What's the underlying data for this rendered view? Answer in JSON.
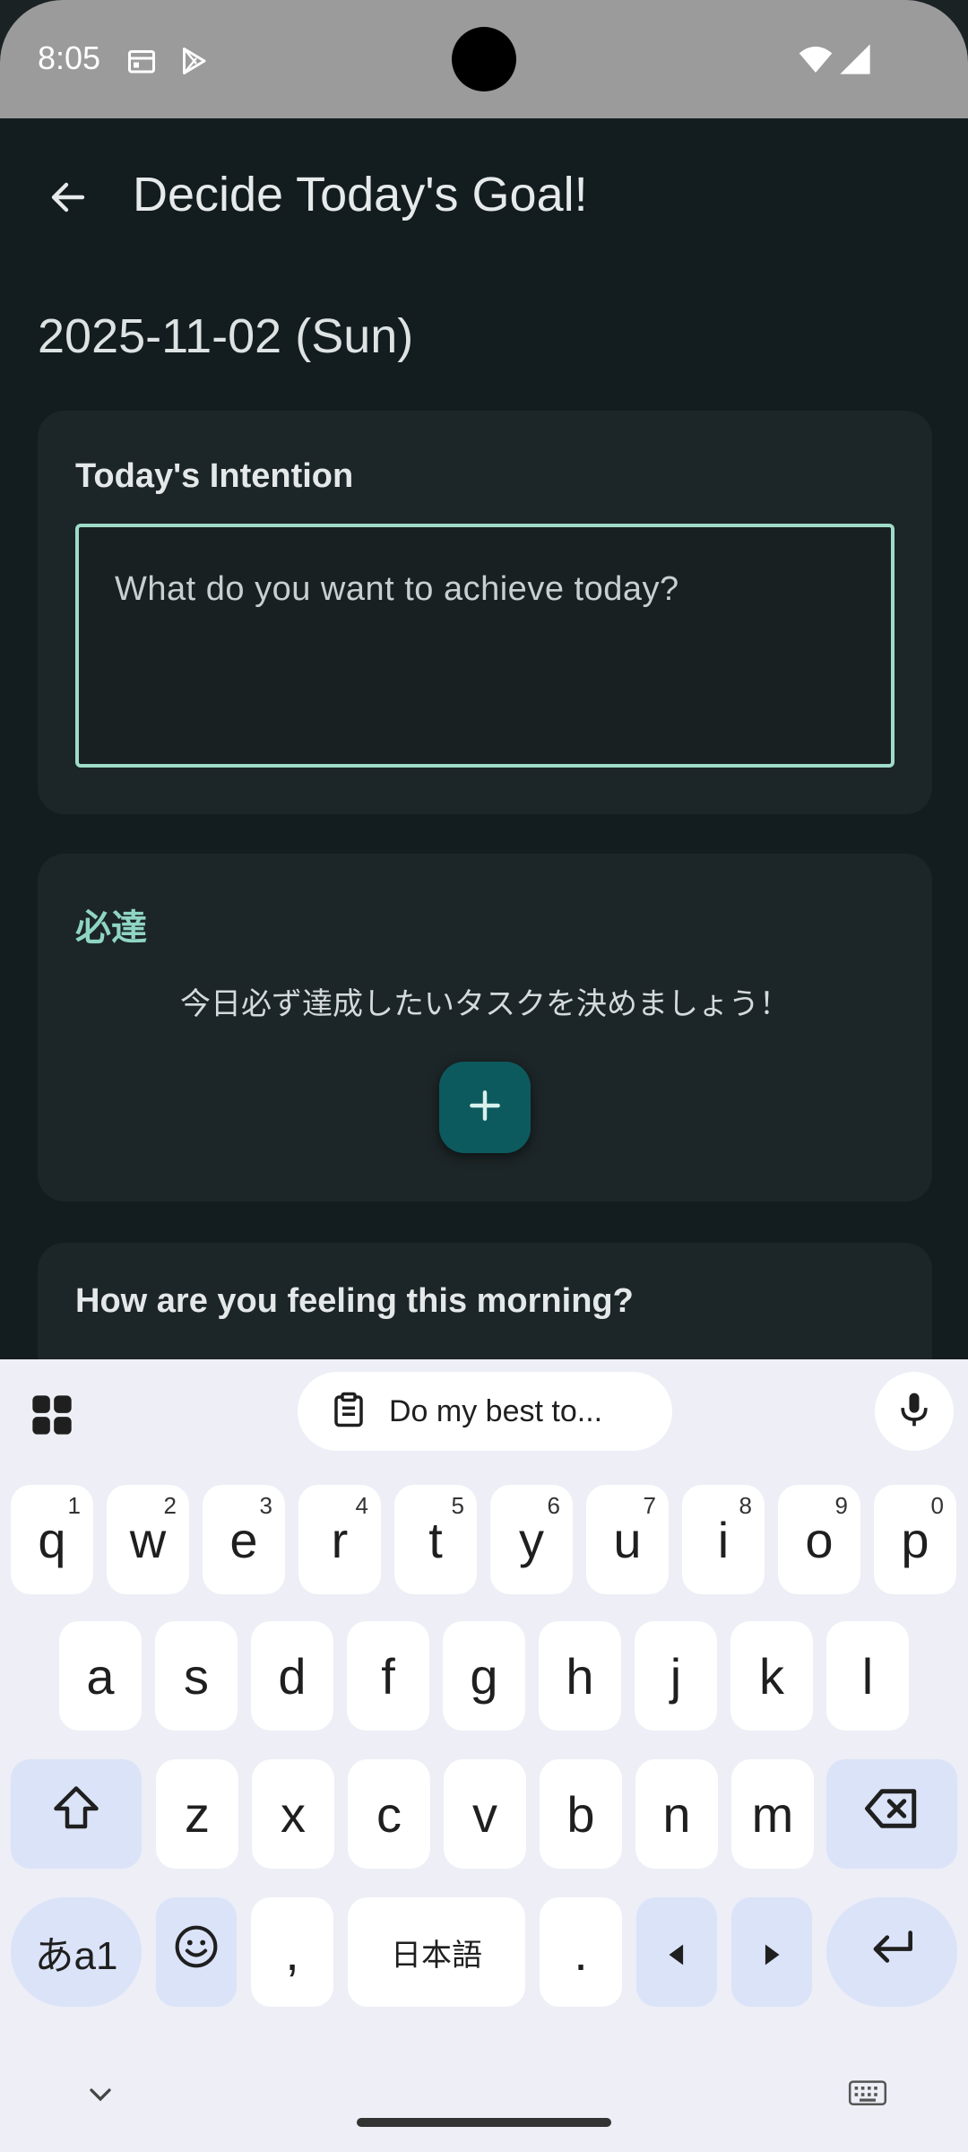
{
  "status_bar": {
    "time": "8:05",
    "icons": [
      "calendar-icon",
      "play-store-icon",
      "wifi-icon",
      "signal-icon"
    ]
  },
  "app_bar": {
    "title": "Decide Today's Goal!",
    "back_icon": "arrow-back-icon"
  },
  "date": "2025-11-02 (Sun)",
  "intention_card": {
    "title": "Today's Intention",
    "placeholder": "What do you want to achieve today?"
  },
  "must_card": {
    "title": "必達",
    "description": "今日必ず達成したいタスクを決めましょう！",
    "add_icon": "plus-icon"
  },
  "feeling_card": {
    "title": "How are you feeling this morning?"
  },
  "keyboard": {
    "suggestion": "Do my best to...",
    "row1": [
      {
        "key": "q",
        "hint": "1"
      },
      {
        "key": "w",
        "hint": "2"
      },
      {
        "key": "e",
        "hint": "3"
      },
      {
        "key": "r",
        "hint": "4"
      },
      {
        "key": "t",
        "hint": "5"
      },
      {
        "key": "y",
        "hint": "6"
      },
      {
        "key": "u",
        "hint": "7"
      },
      {
        "key": "i",
        "hint": "8"
      },
      {
        "key": "o",
        "hint": "9"
      },
      {
        "key": "p",
        "hint": "0"
      }
    ],
    "row2": [
      "a",
      "s",
      "d",
      "f",
      "g",
      "h",
      "j",
      "k",
      "l"
    ],
    "row3": [
      "z",
      "x",
      "c",
      "v",
      "b",
      "n",
      "m"
    ],
    "lang_key": "あa1",
    "comma": ",",
    "space_label": "日本語",
    "period": "."
  },
  "colors": {
    "background": "#131c1e",
    "card": "#1c2527",
    "accent": "#8fd5c4",
    "fab": "#0d5a5e",
    "keyboard_bg": "#edeef6"
  }
}
